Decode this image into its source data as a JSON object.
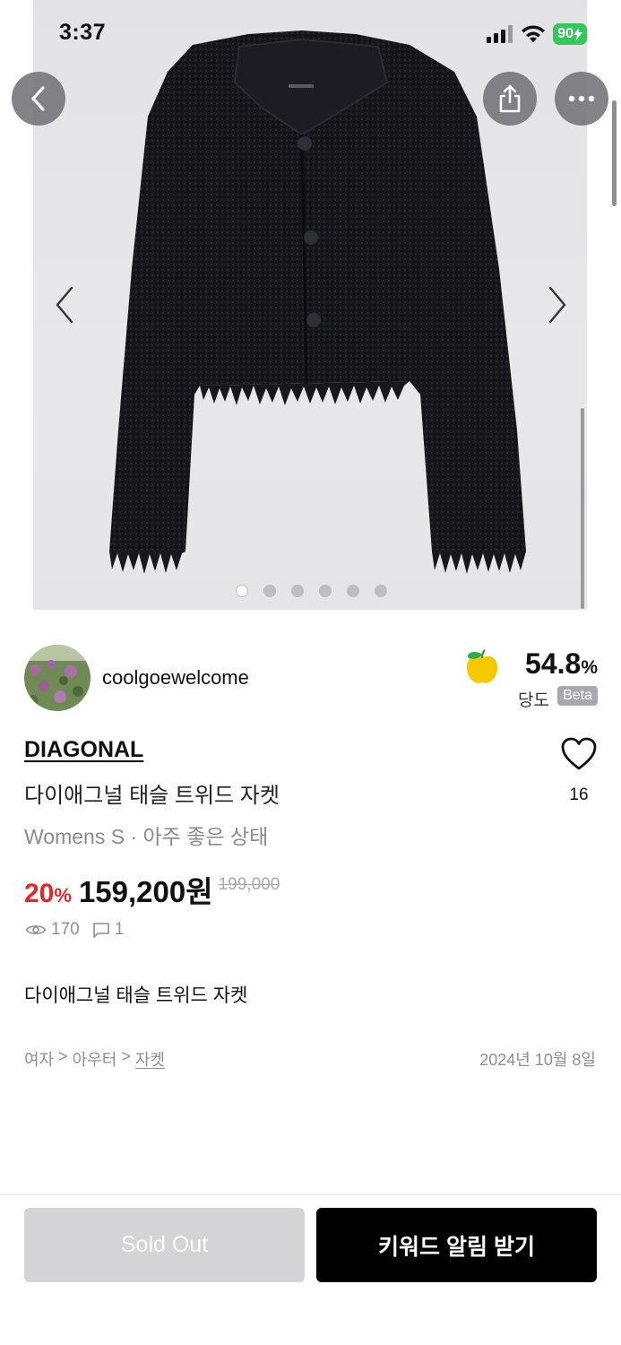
{
  "status_bar": {
    "time": "3:37",
    "battery": "90"
  },
  "gallery": {
    "image_count": 6,
    "active_index": 0
  },
  "seller": {
    "name": "coolgoewelcome"
  },
  "score": {
    "value": "54.8",
    "unit": "%",
    "label": "당도",
    "badge": "Beta"
  },
  "product": {
    "brand": "DIAGONAL",
    "title": "다이애그널 태슬 트위드 자켓",
    "meta": "Womens S · 아주 좋은 상태",
    "discount_value": "20",
    "discount_unit": "%",
    "price": "159,200원",
    "original_price": "199,000",
    "views": "170",
    "comments": "1",
    "likes": "16",
    "description": "다이애그널 태슬 트위드 자켓"
  },
  "breadcrumb": {
    "level1": "여자",
    "sep": ">",
    "level2": "아우터",
    "level3": "자켓"
  },
  "date": "2024년 10월 8일",
  "actions": {
    "sold_out_label": "Sold Out",
    "keyword_label": "키워드 알림 받기"
  },
  "colors": {
    "discount": "#e02a2a",
    "battery": "#34c759",
    "primary_button": "#000000"
  }
}
